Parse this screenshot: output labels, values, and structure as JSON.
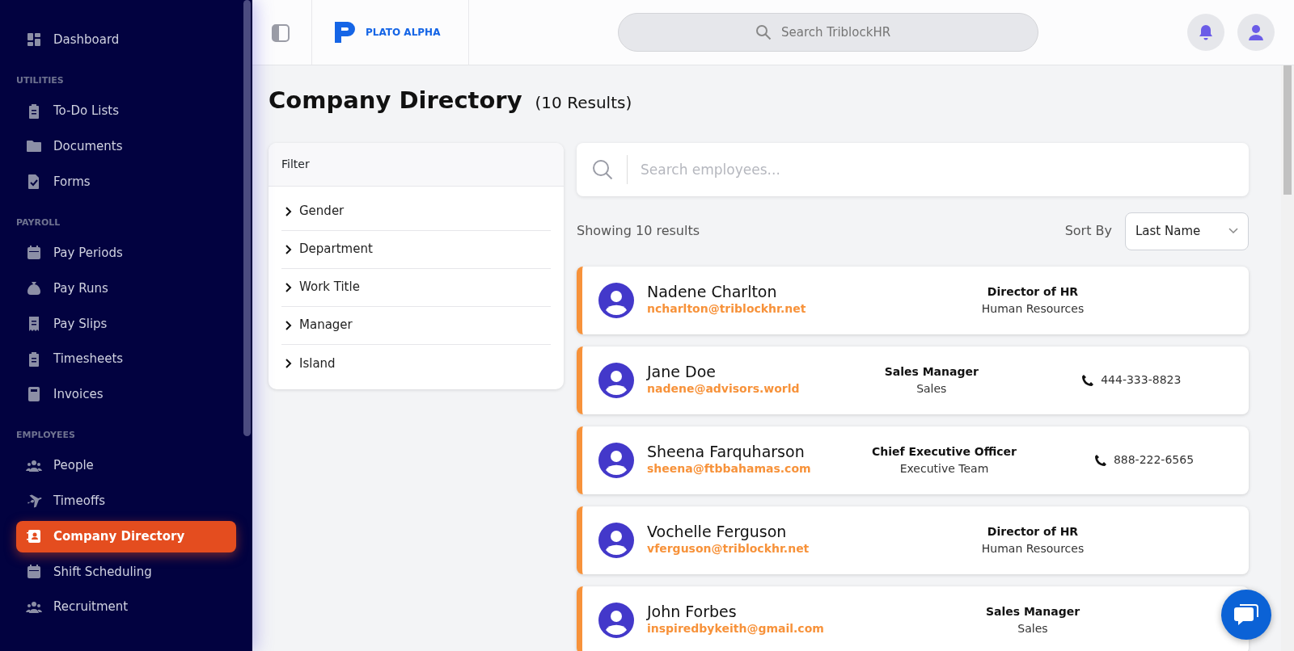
{
  "sidebar": {
    "items": [
      {
        "kind": "link",
        "label": "Dashboard",
        "selected": false
      },
      {
        "kind": "section",
        "label": "UTILITIES"
      },
      {
        "kind": "link",
        "label": "To-Do Lists",
        "selected": false
      },
      {
        "kind": "link",
        "label": "Documents",
        "selected": false
      },
      {
        "kind": "link",
        "label": "Forms",
        "selected": false
      },
      {
        "kind": "section",
        "label": "PAYROLL"
      },
      {
        "kind": "link",
        "label": "Pay Periods",
        "selected": false
      },
      {
        "kind": "link",
        "label": "Pay Runs",
        "selected": false
      },
      {
        "kind": "link",
        "label": "Pay Slips",
        "selected": false
      },
      {
        "kind": "link",
        "label": "Timesheets",
        "selected": false
      },
      {
        "kind": "link",
        "label": "Invoices",
        "selected": false
      },
      {
        "kind": "section",
        "label": "EMPLOYEES"
      },
      {
        "kind": "link",
        "label": "People",
        "selected": false
      },
      {
        "kind": "link",
        "label": "Timeoffs",
        "selected": false
      },
      {
        "kind": "link",
        "label": "Company Directory",
        "selected": true
      },
      {
        "kind": "link",
        "label": "Shift Scheduling",
        "selected": false
      },
      {
        "kind": "link",
        "label": "Recruitment",
        "selected": false
      }
    ]
  },
  "header": {
    "logo_text": "PLATO ALPHA",
    "search": {
      "placeholder": "Search TriblockHR"
    }
  },
  "page": {
    "title": "Company Directory",
    "count": "(10 Results)"
  },
  "filter": {
    "title": "Filter",
    "groups": [
      {
        "label": "Gender",
        "expanded": false
      },
      {
        "label": "Department",
        "expanded": false
      },
      {
        "label": "Work Title",
        "expanded": false
      },
      {
        "label": "Manager",
        "expanded": false
      },
      {
        "label": "Island",
        "expanded": false
      }
    ]
  },
  "directory": {
    "search": {
      "placeholder": "Search employees..."
    },
    "showing": "Showing 10 results",
    "sort_label": "Sort By",
    "sort_value": "Last Name",
    "employees": [
      {
        "name": "Nadene Charlton",
        "email": "ncharlton@triblockhr.net",
        "title": "Director of HR",
        "department": "Human Resources"
      },
      {
        "name": "Jane Doe",
        "email": "nadene@advisors.world",
        "title": "Sales Manager",
        "department": "Sales",
        "phone": "444-333-8823"
      },
      {
        "name": "Sheena Farquharson",
        "email": "sheena@ftbbahamas.com",
        "title": "Chief Executive Officer",
        "department": "Executive Team",
        "phone": "888-222-6565"
      },
      {
        "name": "Vochelle Ferguson",
        "email": "vferguson@triblockhr.net",
        "title": "Director of HR",
        "department": "Human Resources"
      },
      {
        "name": "John Forbes",
        "email": "inspiredbykeith@gmail.com",
        "title": "Sales Manager",
        "department": "Sales"
      }
    ]
  }
}
